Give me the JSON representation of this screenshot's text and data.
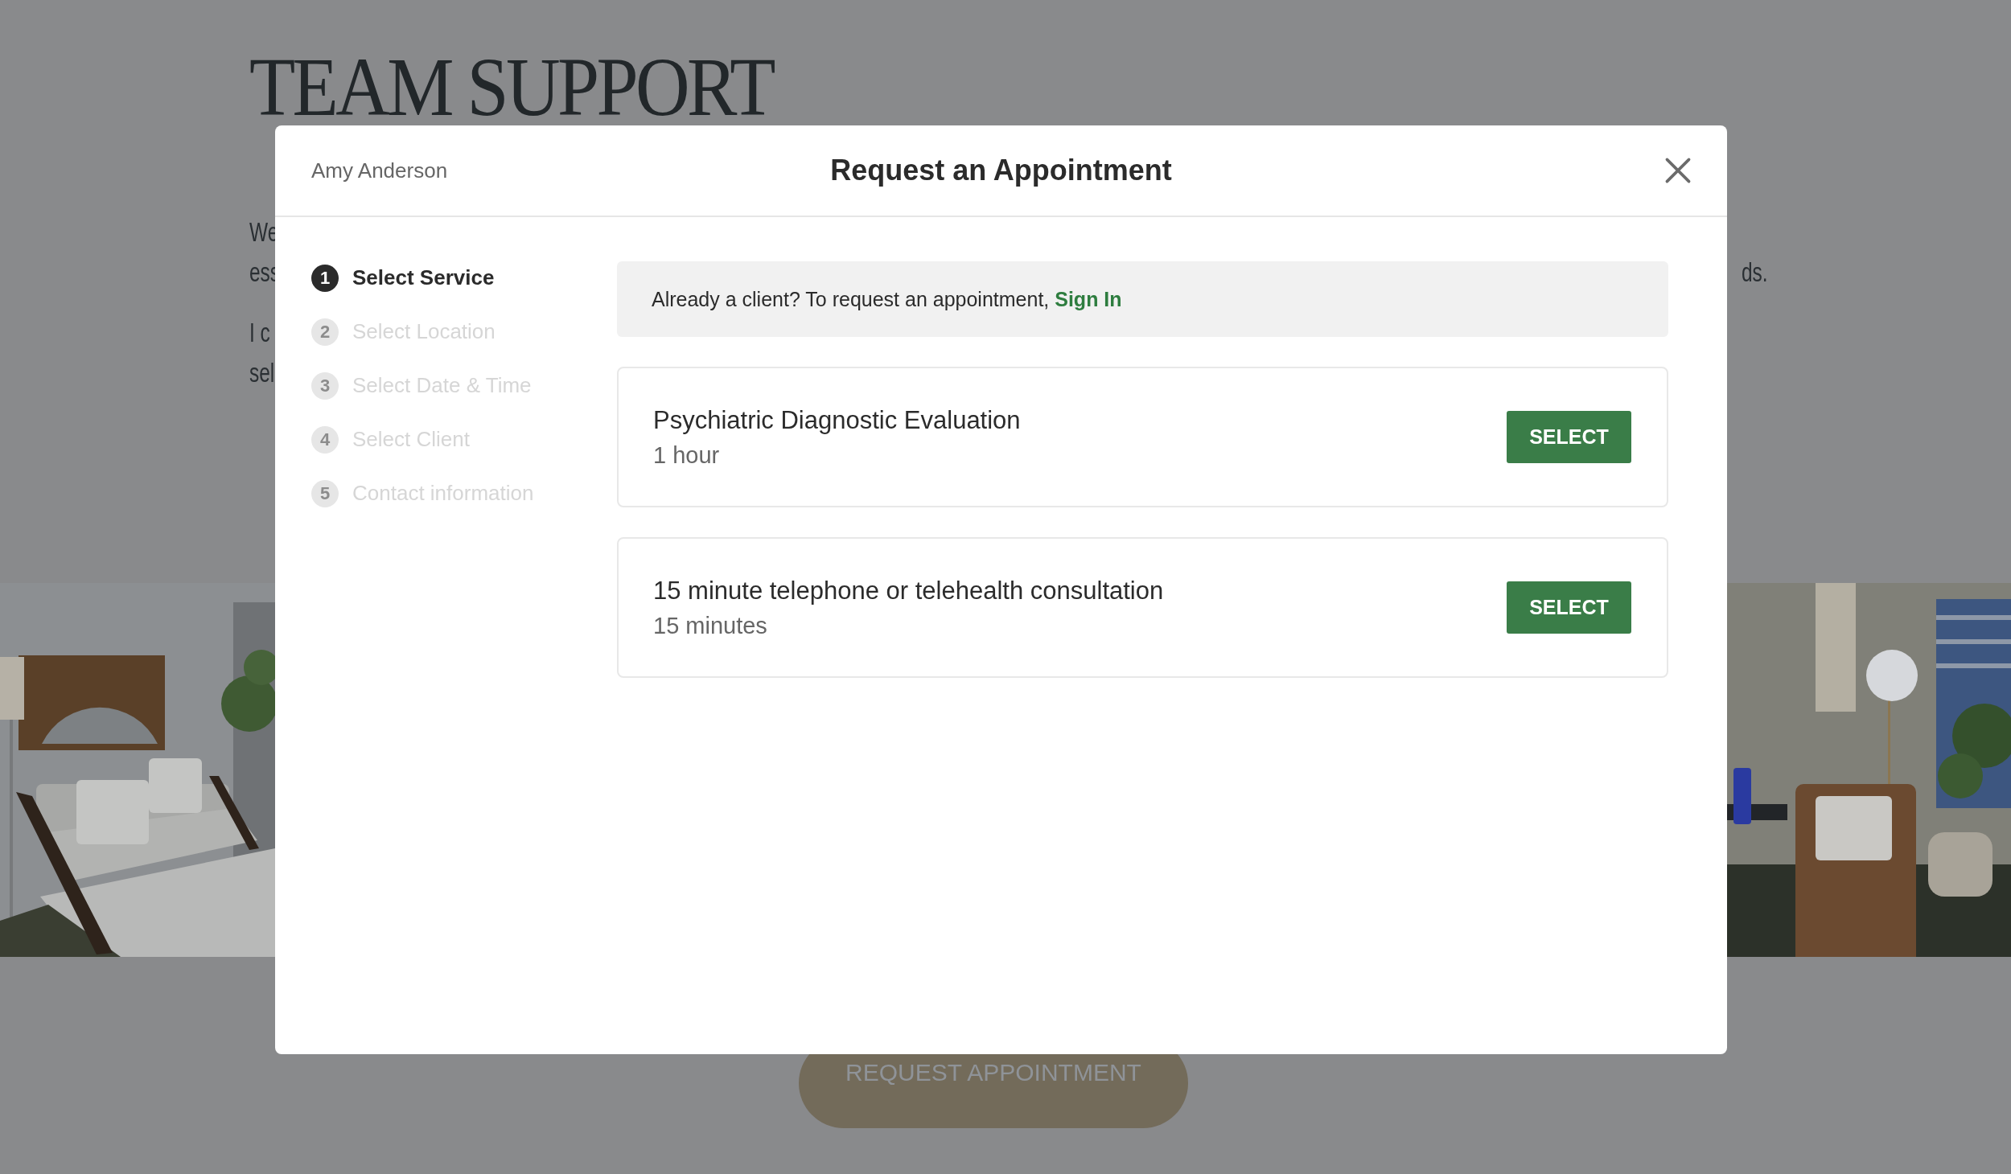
{
  "page": {
    "title": "TEAM SUPPORT",
    "left_fragments": [
      {
        "lines": [
          "We",
          "ess"
        ]
      },
      {
        "lines": [
          "I c",
          "sel"
        ]
      }
    ],
    "right_fragments": [
      "ds."
    ],
    "button": "REQUEST APPOINTMENT"
  },
  "modal": {
    "provider": "Amy Anderson",
    "title": "Request an Appointment",
    "steps": [
      {
        "number": "1",
        "label": "Select Service",
        "selected": true
      },
      {
        "number": "2",
        "label": "Select Location",
        "selected": false
      },
      {
        "number": "3",
        "label": "Select Date & Time",
        "selected": false
      },
      {
        "number": "4",
        "label": "Select Client",
        "selected": false
      },
      {
        "number": "5",
        "label": "Contact information",
        "selected": false
      }
    ],
    "notice": "Already a client? To request an appointment,",
    "notice_link": "Sign In",
    "services": [
      {
        "name": "Psychiatric Diagnostic Evaluation",
        "duration": "1 hour",
        "button": "SELECT"
      },
      {
        "name": "15 minute telephone or telehealth consultation",
        "duration": "15 minutes",
        "button": "SELECT"
      }
    ]
  }
}
